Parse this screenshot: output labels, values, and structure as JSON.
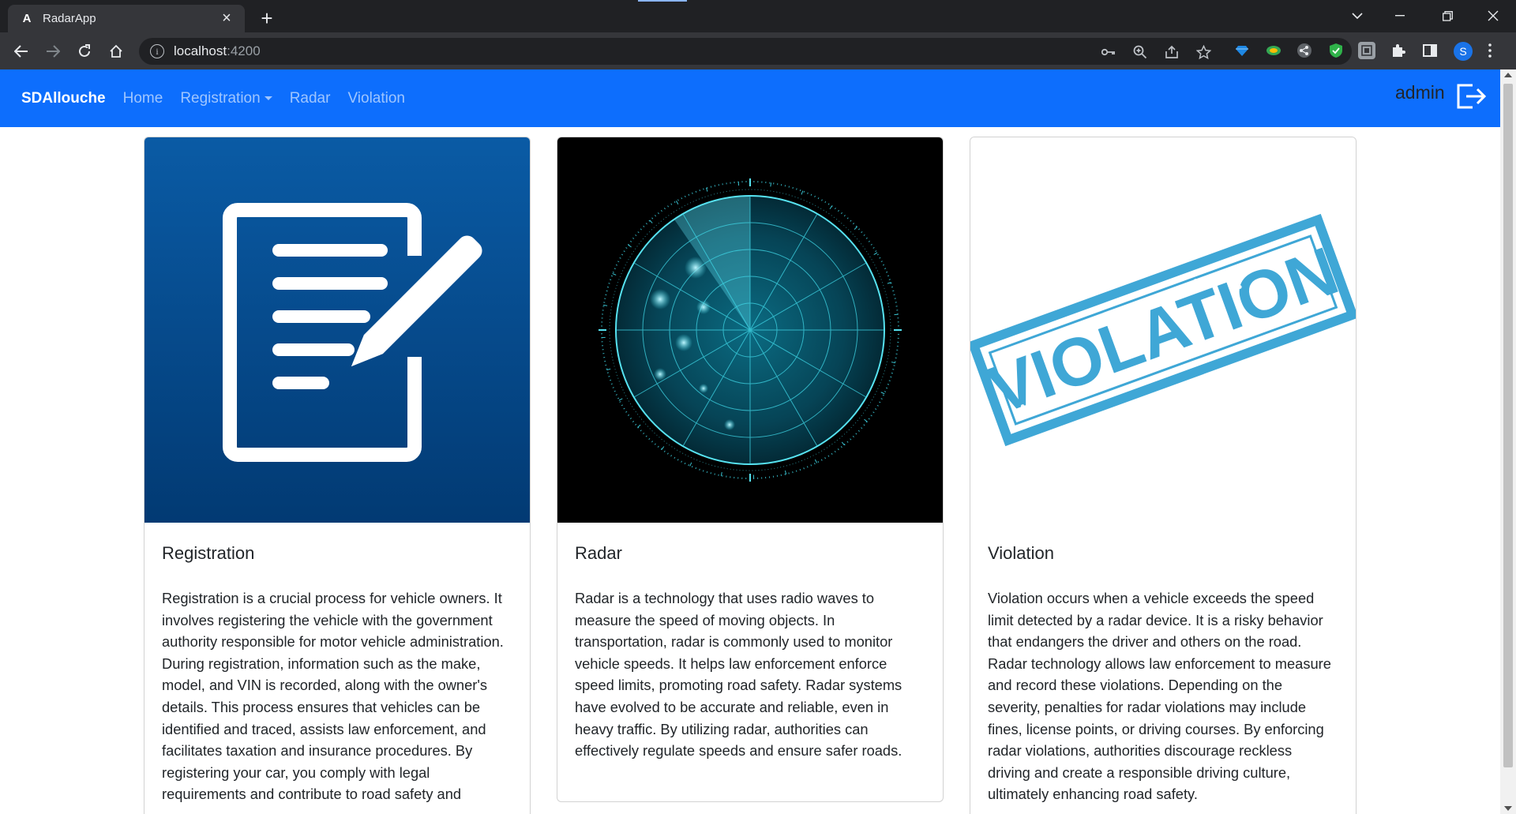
{
  "browser": {
    "tab_title": "RadarApp",
    "tab_favicon": "A",
    "url_host": "localhost",
    "url_port": ":4200",
    "profile_initial": "S"
  },
  "navbar": {
    "brand": "SDAllouche",
    "links": [
      "Home",
      "Registration",
      "Radar",
      "Violation"
    ],
    "user": "admin"
  },
  "cards": [
    {
      "title": "Registration",
      "image": "registration-form-icon",
      "text": "Registration is a crucial process for vehicle owners. It involves registering the vehicle with the government authority responsible for motor vehicle administration. During registration, information such as the make, model, and VIN is recorded, along with the owner's details. This process ensures that vehicles can be identified and traced, assists law enforcement, and facilitates taxation and insurance procedures. By registering your car, you comply with legal requirements and contribute to road safety and"
    },
    {
      "title": "Radar",
      "image": "radar-screen-image",
      "text": "Radar is a technology that uses radio waves to measure the speed of moving objects. In transportation, radar is commonly used to monitor vehicle speeds. It helps law enforcement enforce speed limits, promoting road safety. Radar systems have evolved to be accurate and reliable, even in heavy traffic. By utilizing radar, authorities can effectively regulate speeds and ensure safer roads."
    },
    {
      "title": "Violation",
      "image": "violation-stamp-image",
      "stamp_text": "VIOLATION",
      "text": "Violation occurs when a vehicle exceeds the speed limit detected by a radar device. It is a risky behavior that endangers the driver and others on the road. Radar technology allows law enforcement to measure and record these violations. Depending on the severity, penalties for radar violations may include fines, license points, or driving courses. By enforcing radar violations, authorities discourage reckless driving and create a responsible driving culture, ultimately enhancing road safety."
    }
  ],
  "colors": {
    "navbar": "#0d6efd",
    "registration_bg_top": "#0a5ba5",
    "registration_bg_bottom": "#023a73",
    "radar_cyan": "#3fd6e6",
    "stamp_blue": "#3fa7d6"
  }
}
